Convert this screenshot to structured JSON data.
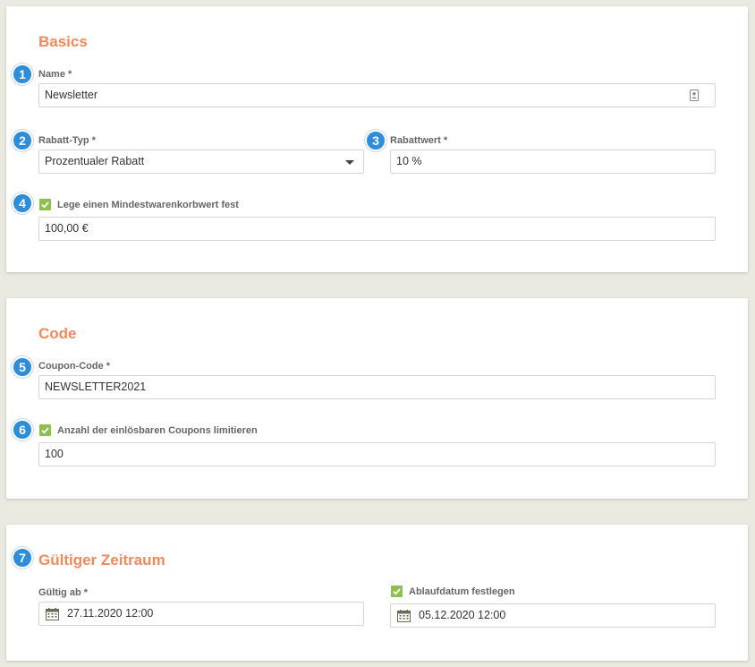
{
  "basics": {
    "title": "Basics",
    "name": {
      "badge": "1",
      "label": "Name *",
      "value": "Newsletter"
    },
    "discount_type": {
      "badge": "2",
      "label": "Rabatt-Typ *",
      "value": "Prozentualer Rabatt"
    },
    "discount_value": {
      "badge": "3",
      "label": "Rabattwert *",
      "value": "10 %"
    },
    "min_cart": {
      "badge": "4",
      "label": "Lege einen Mindestwarenkorbwert fest",
      "checked": true,
      "value": "100,00 €"
    }
  },
  "code": {
    "title": "Code",
    "coupon_code": {
      "badge": "5",
      "label": "Coupon-Code *",
      "value": "NEWSLETTER2021"
    },
    "limit": {
      "badge": "6",
      "label": "Anzahl der einlösbaren Coupons limitieren",
      "checked": true,
      "value": "100"
    }
  },
  "period": {
    "badge": "7",
    "title": "Gültiger Zeitraum",
    "valid_from": {
      "label": "Gültig ab *",
      "value": "27.11.2020 12:00"
    },
    "expiry": {
      "label": "Ablaufdatum festlegen",
      "checked": true,
      "value": "05.12.2020 12:00"
    }
  },
  "colors": {
    "accent": "#ef8a5d",
    "badge": "#2e8dd8",
    "checkbox": "#8dc04f",
    "background": "#ebeae1"
  },
  "icons": {
    "name_field": "contact-card-icon",
    "select": "caret-down-icon",
    "date": "calendar-icon",
    "checkbox": "checkmark-icon"
  }
}
